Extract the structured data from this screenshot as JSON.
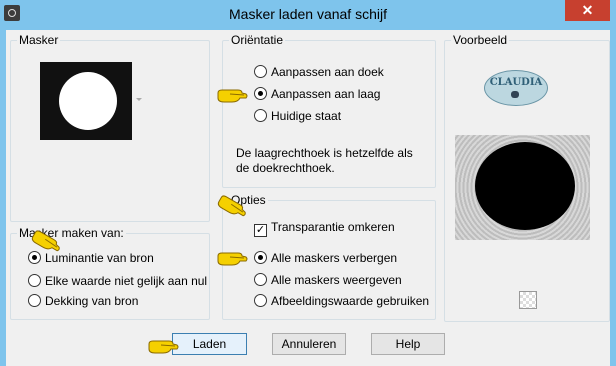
{
  "window": {
    "title": "Masker laden vanaf schijf",
    "close_glyph": "✕"
  },
  "masker_group": {
    "title": "Masker"
  },
  "maken_van": {
    "title": "Masker maken van:",
    "options": [
      {
        "label": "Luminantie van bron",
        "selected": true
      },
      {
        "label": "Elke waarde niet gelijk aan nul",
        "selected": false
      },
      {
        "label": "Dekking van bron",
        "selected": false
      }
    ]
  },
  "orientatie": {
    "title": "Oriëntatie",
    "options": [
      {
        "label": "Aanpassen aan doek",
        "selected": false
      },
      {
        "label": "Aanpassen aan laag",
        "selected": true
      },
      {
        "label": "Huidige staat",
        "selected": false
      }
    ],
    "description": "De laagrechthoek is hetzelfde als de doekrechthoek."
  },
  "opties": {
    "title": "Opties",
    "transparantie_label": "Transparantie omkeren",
    "transparantie_checked": true,
    "options": [
      {
        "label": "Alle maskers verbergen",
        "selected": true
      },
      {
        "label": "Alle maskers weergeven",
        "selected": false
      },
      {
        "label": "Afbeeldingswaarde gebruiken",
        "selected": false
      }
    ]
  },
  "voorbeeld": {
    "title": "Voorbeeld",
    "logo_text": "CLAUDIA"
  },
  "buttons": {
    "laden": "Laden",
    "annuleren": "Annuleren",
    "help": "Help"
  },
  "colors": {
    "titlebar": "#7ec4ec",
    "close": "#c7402f",
    "pointer_hand": "#f5d000"
  }
}
